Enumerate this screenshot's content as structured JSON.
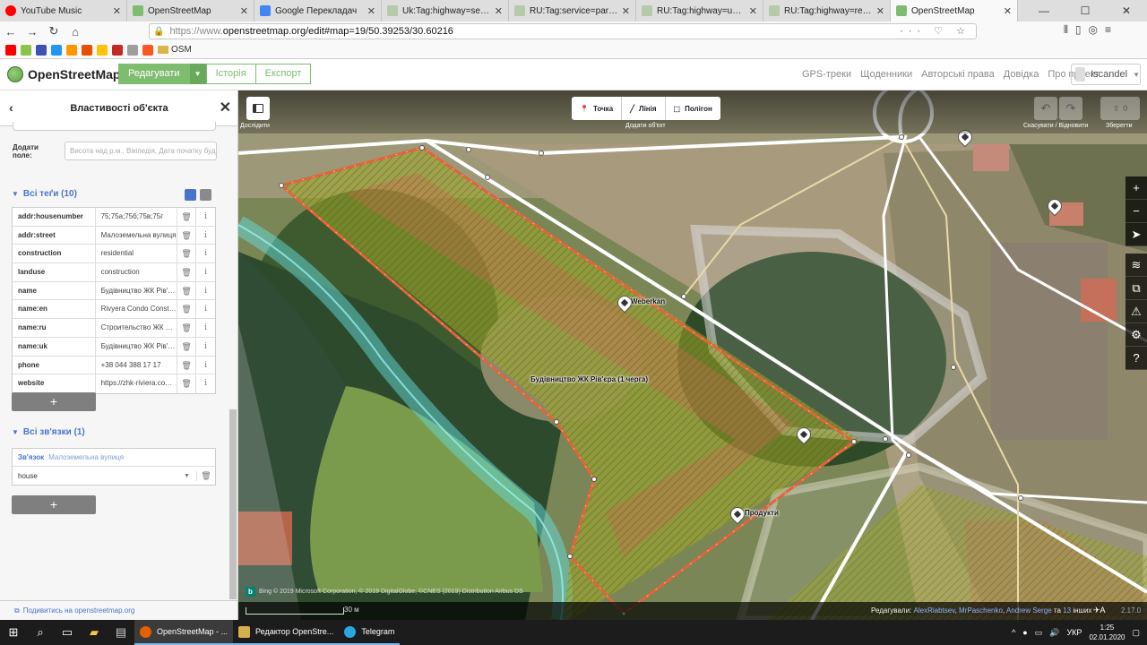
{
  "browser": {
    "tabs": [
      {
        "title": "YouTube Music",
        "color": "#ff0000",
        "active": false
      },
      {
        "title": "OpenStreetMap",
        "color": "#7ebc6f",
        "active": false
      },
      {
        "title": "Google Перекладач",
        "color": "#4285f4",
        "active": false
      },
      {
        "title": "Uk:Tag:highway=service — O",
        "color": "#b7c9a8",
        "active": false
      },
      {
        "title": "RU:Tag:service=parking_aisle",
        "color": "#b7c9a8",
        "active": false
      },
      {
        "title": "RU:Tag:highway=unclassified",
        "color": "#b7c9a8",
        "active": false
      },
      {
        "title": "RU:Tag:highway=residential",
        "color": "#b7c9a8",
        "active": false
      },
      {
        "title": "OpenStreetMap",
        "color": "#7ebc6f",
        "active": true
      }
    ],
    "url_prefix": "https://www.",
    "url_main": "openstreetmap.org/edit#map=19/50.39253/30.60216",
    "bookmark_folder": "OSM"
  },
  "osm": {
    "logo_text": "OpenStreetMap",
    "edit_button": "Редагувати",
    "history_button": "Історія",
    "export_button": "Експорт",
    "nav_links": [
      "GPS-треки",
      "Щоденники",
      "Авторські права",
      "Довідка",
      "Про проект"
    ],
    "username": "Iscandel"
  },
  "sidebar": {
    "title": "Властивості об'єкта",
    "add_field_label": "Додати поле:",
    "add_field_placeholder": "Висота над р.м., Вікіпедія, Дата початку будівництва…",
    "tags_title": "Всі теґи (10)",
    "tags": [
      {
        "key": "addr:housenumber",
        "value": "75;75a;75б;75в;75г"
      },
      {
        "key": "addr:street",
        "value": "Малоземельна вулиця"
      },
      {
        "key": "construction",
        "value": "residential"
      },
      {
        "key": "landuse",
        "value": "construction"
      },
      {
        "key": "name",
        "value": "Будівництво ЖК Рів'єра"
      },
      {
        "key": "name:en",
        "value": "Rivyera Condo Construction"
      },
      {
        "key": "name:ru",
        "value": "Строительство ЖК Ривьера"
      },
      {
        "key": "name:uk",
        "value": "Будівництво ЖК Рів'єра"
      },
      {
        "key": "phone",
        "value": "+38 044 388 17 17"
      },
      {
        "key": "website",
        "value": "https://zhk-riviera.com.ua"
      }
    ],
    "add_tag_label": "+",
    "relations_title": "Всі зв'язки (1)",
    "relation_type": "Зв'язок",
    "relation_name": "Малоземельна вулиця",
    "relation_role": "house",
    "add_relation_label": "+",
    "footer_link": "Подивитись на openstreetmap.org"
  },
  "map": {
    "panel_label": "Дослідити",
    "add_point": "Точка",
    "add_line": "Лінія",
    "add_area": "Полігон",
    "add_label": "Додати об'єкт",
    "undo_label": "Скасувати / Відновити",
    "save_count": "0",
    "save_label": "Зберегти",
    "labels": {
      "area_name": "Будівництво ЖК Рів'єра (1 черга)",
      "poi1": "Weberkan",
      "poi2": "Продукти"
    },
    "attribution": "Bing  © 2019 Microsoft Corporation, © 2019 DigitalGlobe, ©CNES (2019) Distribution Airbus DS",
    "scale": "30 м",
    "editors_prefix": "Редагували:",
    "editors": [
      "AlexRiabtsev",
      "MrPaschenko",
      "Andrew Serge"
    ],
    "editors_more_pre": "та",
    "editors_more_count": "13",
    "editors_more_post": "інших",
    "version": "2.17.0"
  },
  "taskbar": {
    "apps": [
      {
        "label": "OpenStreetMap - ...",
        "color": "#e66000"
      },
      {
        "label": "Редактор OpenStre...",
        "color": "#d4b04c"
      },
      {
        "label": "Telegram",
        "color": "#2ca5e0"
      }
    ],
    "lang": "УКР",
    "time": "1:25",
    "date": "02.01.2020"
  }
}
